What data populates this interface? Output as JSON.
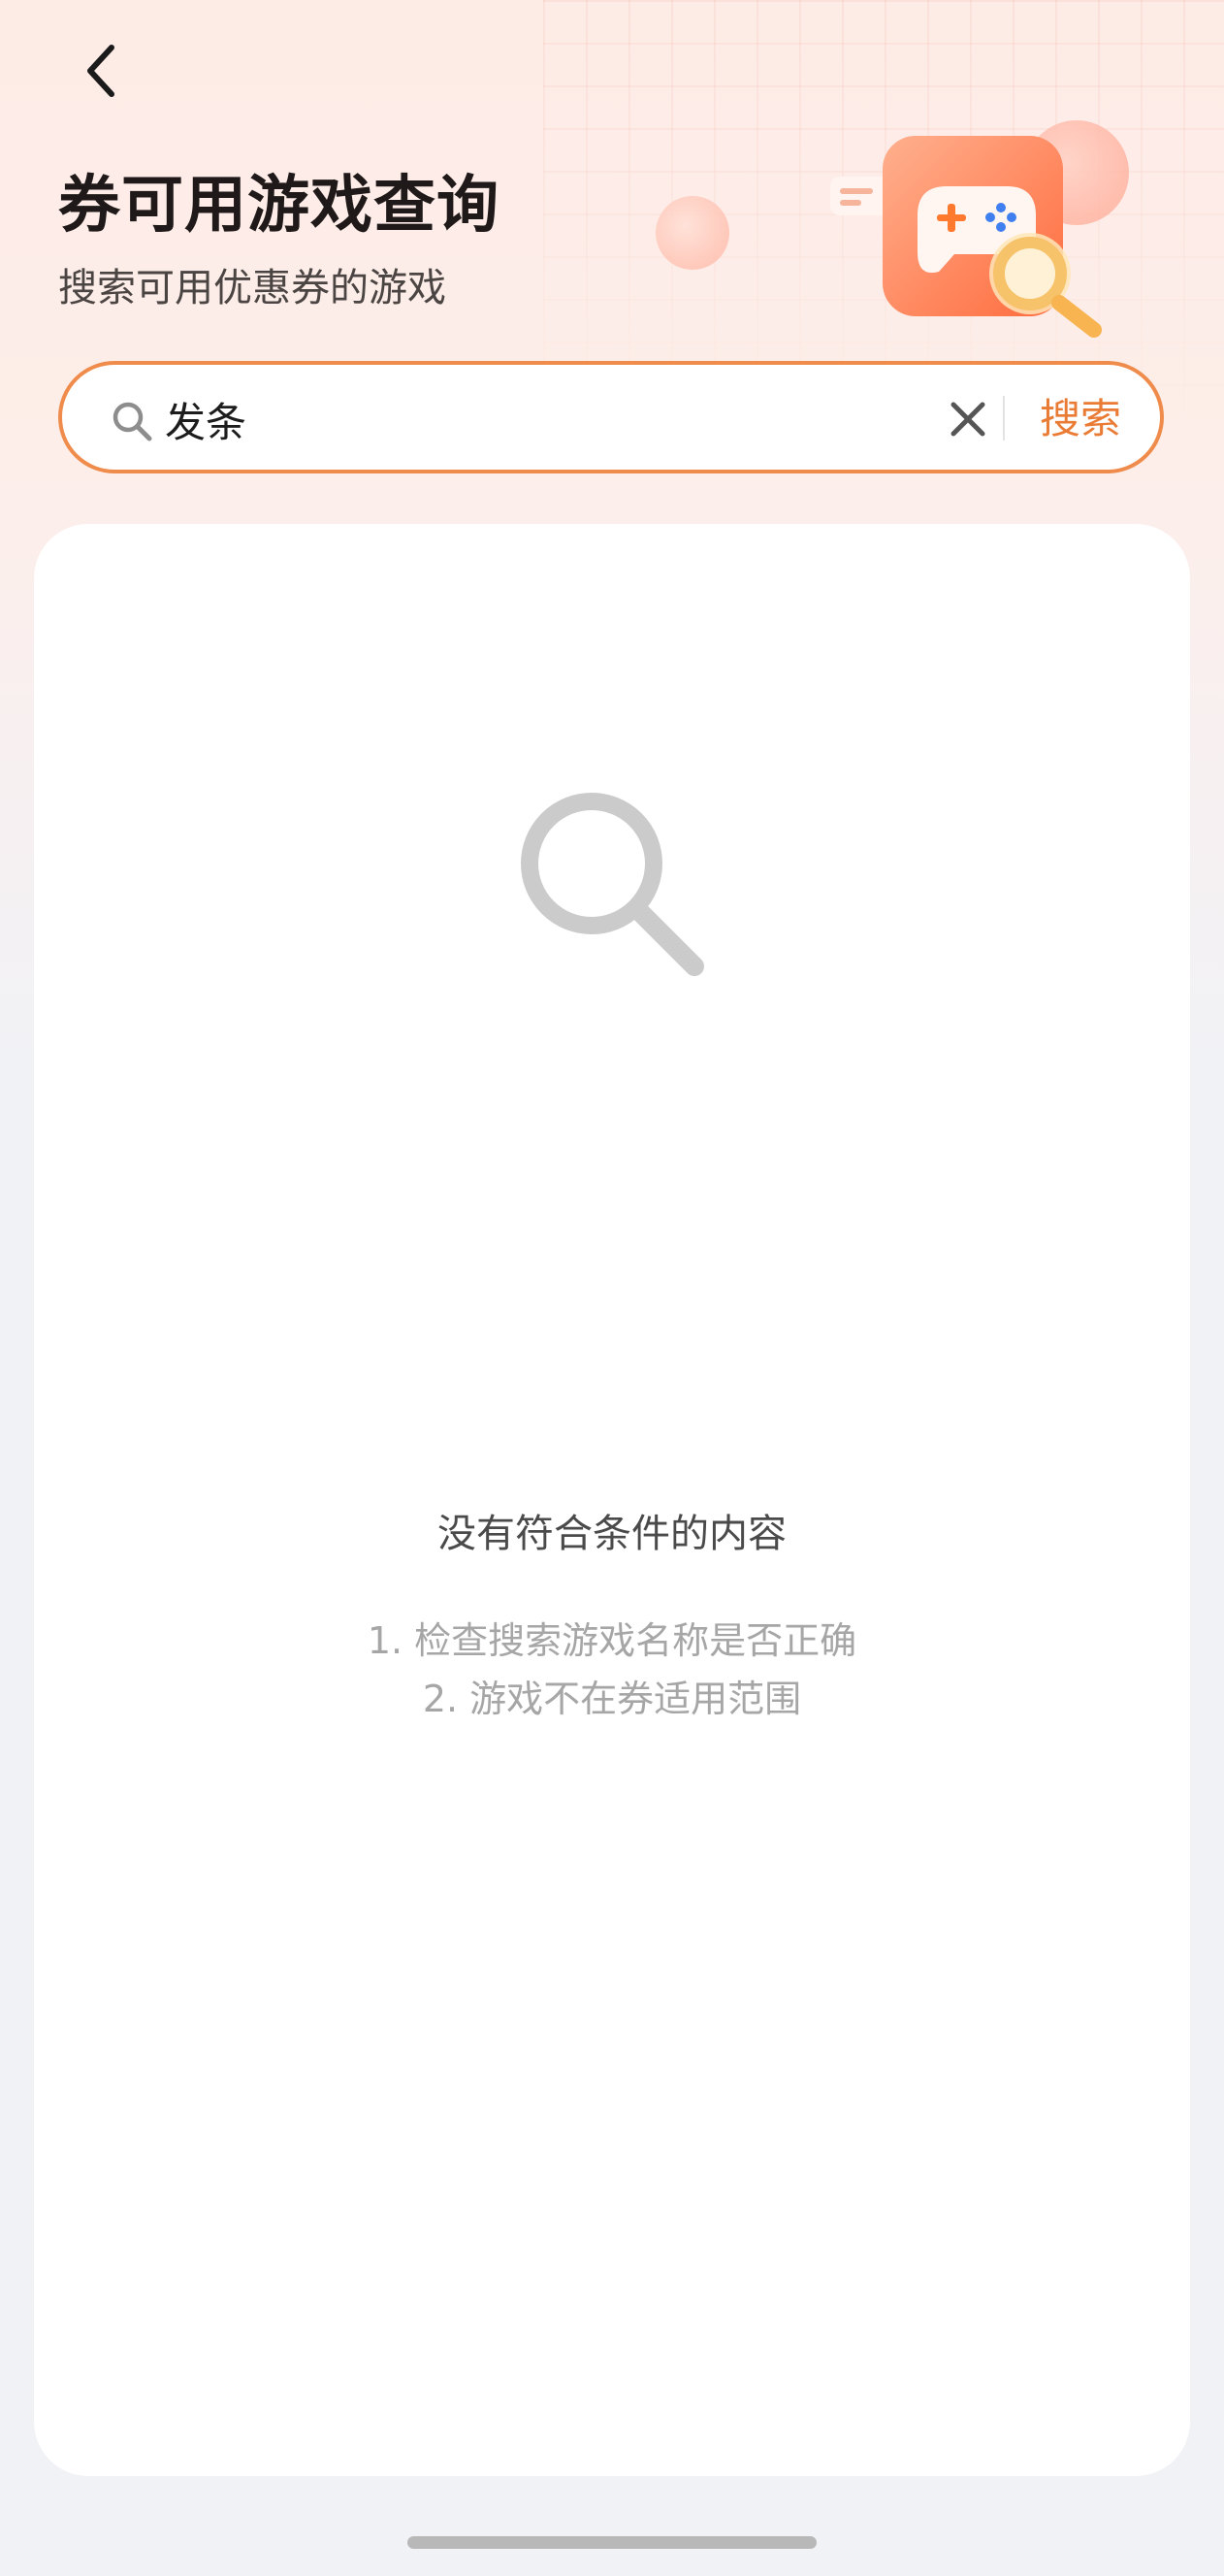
{
  "header": {
    "back_icon": "chevron-left-icon",
    "title": "券可用游戏查询",
    "subtitle": "搜索可用优惠券的游戏",
    "illustration": "game-controller-search-illustration"
  },
  "search": {
    "icon": "search-icon",
    "value": "发条",
    "placeholder": "",
    "clear_icon": "close-icon",
    "button_label": "搜索"
  },
  "empty_state": {
    "icon": "search-icon",
    "title": "没有符合条件的内容",
    "tips": [
      "1. 检查搜索游戏名称是否正确",
      "2. 游戏不在券适用范围"
    ]
  },
  "colors": {
    "accent": "#ea7b35",
    "search_border": "#ef8c4c",
    "title": "#1f1a19",
    "muted": "#a6a6a6"
  }
}
